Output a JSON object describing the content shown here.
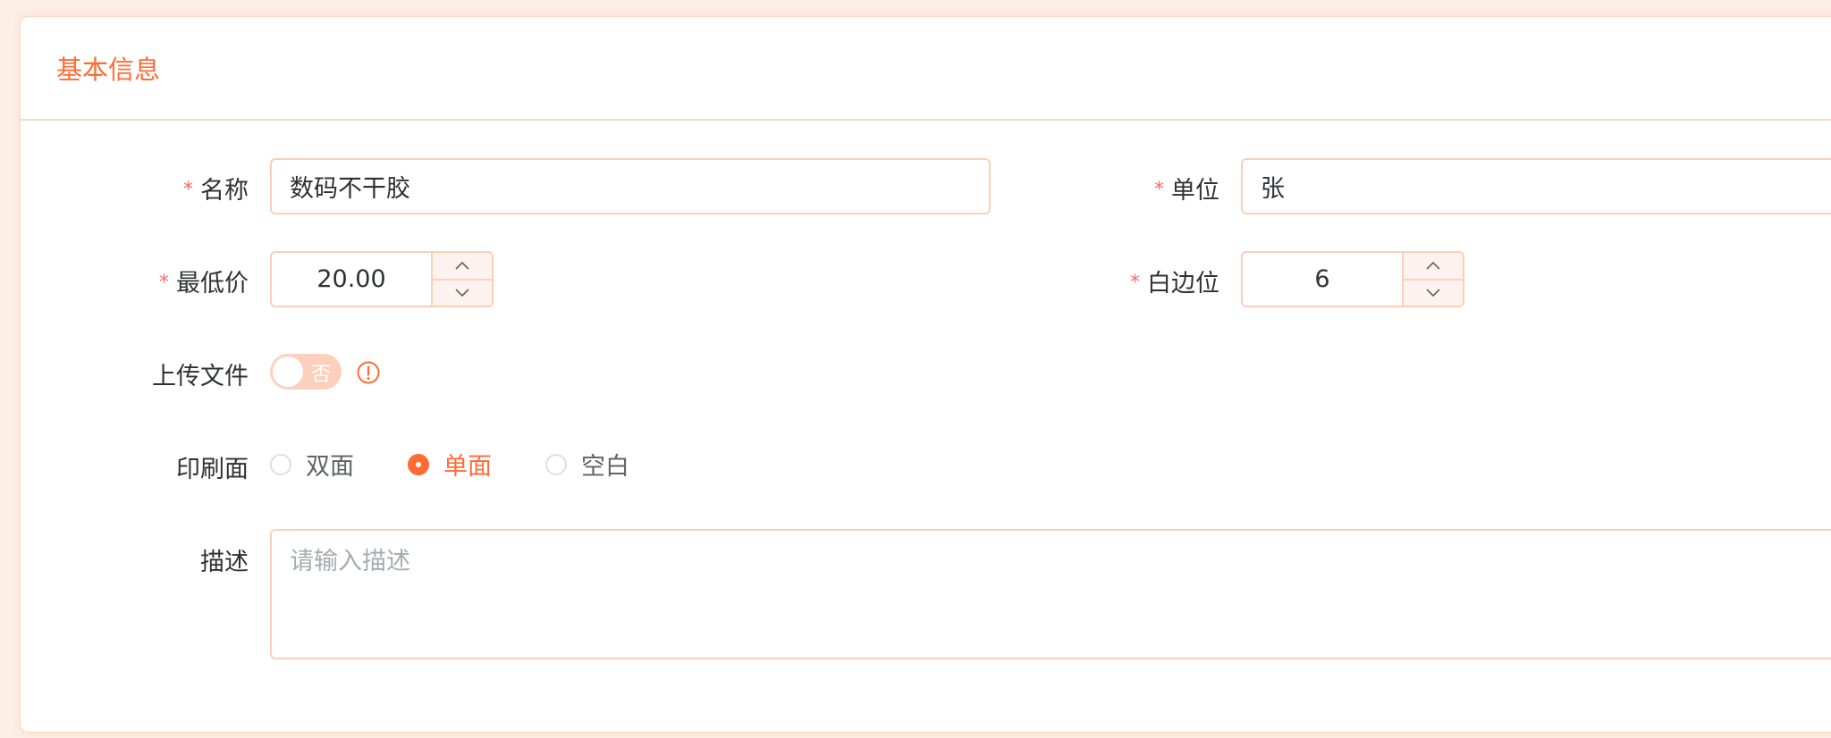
{
  "section": {
    "title": "基本信息"
  },
  "fields": {
    "name": {
      "label": "名称",
      "required_mark": "*",
      "value": "数码不干胶"
    },
    "unit": {
      "label": "单位",
      "required_mark": "*",
      "value": "张"
    },
    "min_price": {
      "label": "最低价",
      "required_mark": "*",
      "value": "20.00"
    },
    "margin": {
      "label": "白边位",
      "required_mark": "*",
      "value": "6"
    },
    "upload_file": {
      "label": "上传文件",
      "switch_text": "否",
      "enabled": false
    },
    "print_side": {
      "label": "印刷面",
      "options": [
        "双面",
        "单面",
        "空白"
      ],
      "selected": "单面"
    },
    "description": {
      "label": "描述",
      "placeholder": "请输入描述"
    }
  },
  "colors": {
    "accent": "#ff6b35",
    "required": "#f56c6c",
    "border": "#fbcfb9",
    "page_bg": "#fdeee6"
  },
  "icons": {
    "stepper_up": "chevron-up-icon",
    "stepper_down": "chevron-down-icon",
    "info": "exclamation-circle-icon"
  }
}
